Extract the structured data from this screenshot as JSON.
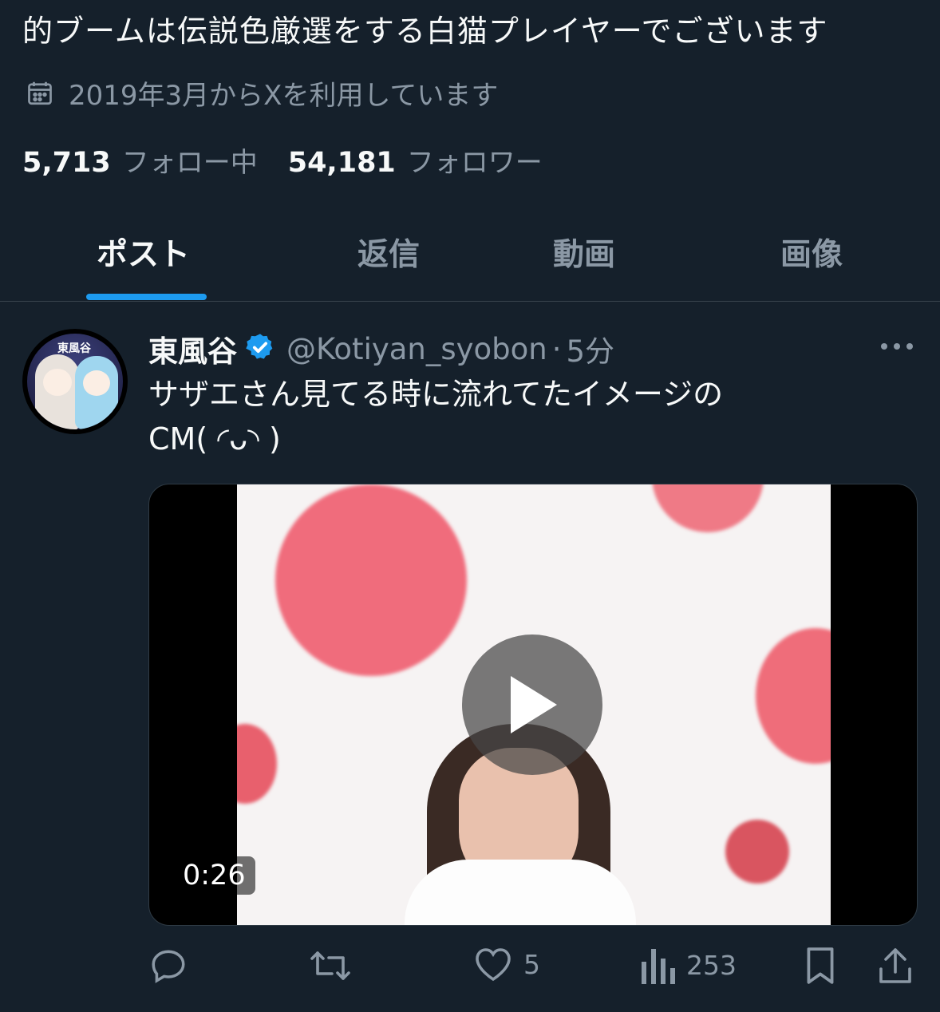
{
  "profile": {
    "bio_line": "的ブームは伝説色厳選をする白猫プレイヤーでございます",
    "joined": "2019年3月からXを利用しています",
    "following_count": "5,713",
    "following_label": "フォロー中",
    "followers_count": "54,181",
    "followers_label": "フォロワー"
  },
  "tabs": [
    {
      "label": "ポスト",
      "active": true
    },
    {
      "label": "返信",
      "active": false
    },
    {
      "label": "動画",
      "active": false
    },
    {
      "label": "画像",
      "active": false
    }
  ],
  "tweet": {
    "avatar_text": "東風谷",
    "display_name": "東風谷",
    "verified": true,
    "handle": "@Kotiyan_syobon",
    "separator": "·",
    "time": "5分",
    "text_line1": "サザエさん見てる時に流れてたイメージの",
    "text_line2": "CM( ◜ᴗ◝ )",
    "media": {
      "type": "video",
      "duration": "0:26"
    },
    "actions": {
      "reply_count": "",
      "retweet_count": "",
      "like_count": "5",
      "views_count": "253"
    }
  },
  "colors": {
    "background": "#15202b",
    "accent": "#1d9bf0",
    "muted_text": "#8b98a5",
    "primary_text": "#f7f9f9"
  },
  "icons": {
    "calendar": "calendar-icon",
    "verified": "verified-badge-icon",
    "more": "more-icon",
    "play": "play-icon",
    "reply": "reply-icon",
    "retweet": "retweet-icon",
    "like": "heart-icon",
    "views": "views-icon",
    "bookmark": "bookmark-icon",
    "share": "share-icon"
  }
}
